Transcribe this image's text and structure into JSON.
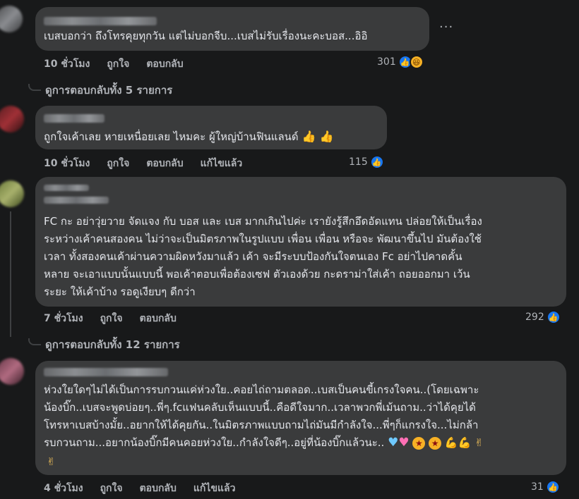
{
  "comments": [
    {
      "text_lines": [
        "เบสบอกว่า ถึงโทรคุยทุกวัน แต่ไม่บอกจีบ...เบสไม่รับเรื่องนะคะบอส...อิอิ"
      ],
      "time": "10 ชั่วโมง",
      "like_label": "ถูกใจ",
      "reply_label": "ตอบกลับ",
      "reaction_count": "301",
      "more_label": "···",
      "replies_link": "ดูการตอบกลับทั้ง 5 รายการ"
    },
    {
      "text_lines": [
        "ถูกใจเค้าเลย หายเหนื่อยเลย ไหมคะ ผู้ใหญ่บ้านฟินแลนด์"
      ],
      "thumbs": "👍 👍",
      "time": "10 ชั่วโมง",
      "like_label": "ถูกใจ",
      "reply_label": "ตอบกลับ",
      "edited_label": "แก้ไขแล้ว",
      "reaction_count": "115"
    },
    {
      "text_lines": [
        "FC กะ อย่าวุ่ยวาย จัดแจง กับ บอส และ เบส มากเกินไปค่ะ เรายังรู้สึกอึดอัดแทน ปล่อยให้เป็นเรื่อง",
        "ระหว่างเค้าคนสองคน ไม่ว่าจะเป็นมิตรภาพในรูปแบบ เพื่อน เพื่อน หรือจะ พัฒนาขึ้นไป มันต้องใช้",
        "เวลา ทั้งสองคนเค้าผ่านความผิดหวังมาแล้ว เค้า จะมีระบบป้องกันใจตนเอง Fc อย่าไปคาดคั้น",
        "หลาย จะเอาแบบนั้นแบบนี้ พอเค้าตอบเพื่อต้องเซฟ ตัวเองด้วย กะดราม่าใส่เค้า ถอยออกมา เว้น",
        "ระยะ ให้เค้าบ้าง รอดูเงียบๆ ดีกว่า"
      ],
      "time": "7 ชั่วโมง",
      "like_label": "ถูกใจ",
      "reply_label": "ตอบกลับ",
      "reaction_count": "292",
      "replies_link": "ดูการตอบกลับทั้ง 12 รายการ"
    },
    {
      "text_lines": [
        "ห่วงใยใดๆไม่ได้เป็นการรบกวนแค่ห่วงใย..คอยไถ่ถามตลอด..เบสเป็นคนขี้เกรงใจคน..(โดยเฉพาะ",
        "น้องบิ๊ก..เบสจะพูดบ่อยๆ..พี่ๆ.fcแฟนคลับเห็นแบบนี้..คือดีใจมาก..เวลาพวกพี่เม้นถาม..ว่าได้คุยได้",
        "โทรหาเบสบ้างมั้ย..อยากให้ได้คุยกัน..ในมิตรภาพแบบถามไถ่มันมีกำลังใจ...พี่ๆก็แกรงใจ...ไม่กล้า",
        "รบกวนถาม...อยากน้องบิ๊กมีคนคอยห่วงใย..กำลังใจดีๆ..อยู่ที่น้องบิ๊กแล้วนะ.."
      ],
      "time": "4 ชั่วโมง",
      "like_label": "ถูกใจ",
      "reply_label": "ตอบกลับ",
      "edited_label": "แก้ไขแล้ว",
      "reaction_count": "31"
    }
  ],
  "icons": {
    "like": "like-icon",
    "haha": "haha-icon",
    "more": "more-icon"
  },
  "colors": {
    "background": "#18191a",
    "bubble": "#3a3b3c",
    "text": "#e4e6eb",
    "secondary_text": "#b0b3b8",
    "like_blue": "#1877f2"
  }
}
